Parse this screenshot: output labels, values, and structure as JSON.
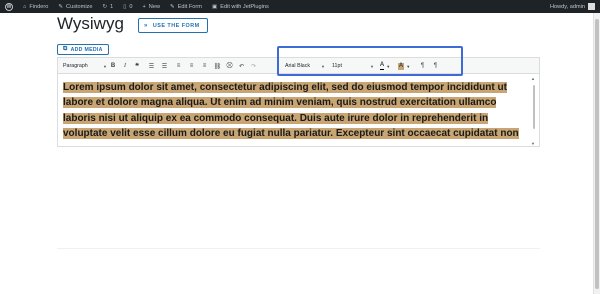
{
  "adminbar": {
    "site_name": "Findero",
    "customize": "Customize",
    "updates_count": "1",
    "comments_count": "0",
    "new_label": "New",
    "edit_form": "Edit Form",
    "edit_with": "Edit with JetPlugins",
    "howdy": "Howdy, admin"
  },
  "header": {
    "title": "Wysiwyg",
    "use_form_label": "USE THE FORM"
  },
  "editor": {
    "add_media_label": "ADD MEDIA",
    "format_select": "Paragraph",
    "font_family": "Arial Black",
    "font_size": "11pt",
    "text_color_label": "A",
    "bg_color_label": "A",
    "highlight_color": "#c8a572",
    "annotation_color": "#3e6bd6",
    "content": "Lorem ipsum dolor sit amet, consectetur adipiscing elit, sed do eiusmod tempor incididunt ut labore et dolore magna aliqua. Ut enim ad minim veniam, quis nostrud exercitation ullamco laboris nisi ut aliquip ex ea commodo consequat. Duis aute irure dolor in reprehenderit in voluptate velit esse cillum dolore eu fugiat nulla pariatur. Excepteur sint occaecat cupidatat non proident, sunt in culpa qui officia"
  }
}
